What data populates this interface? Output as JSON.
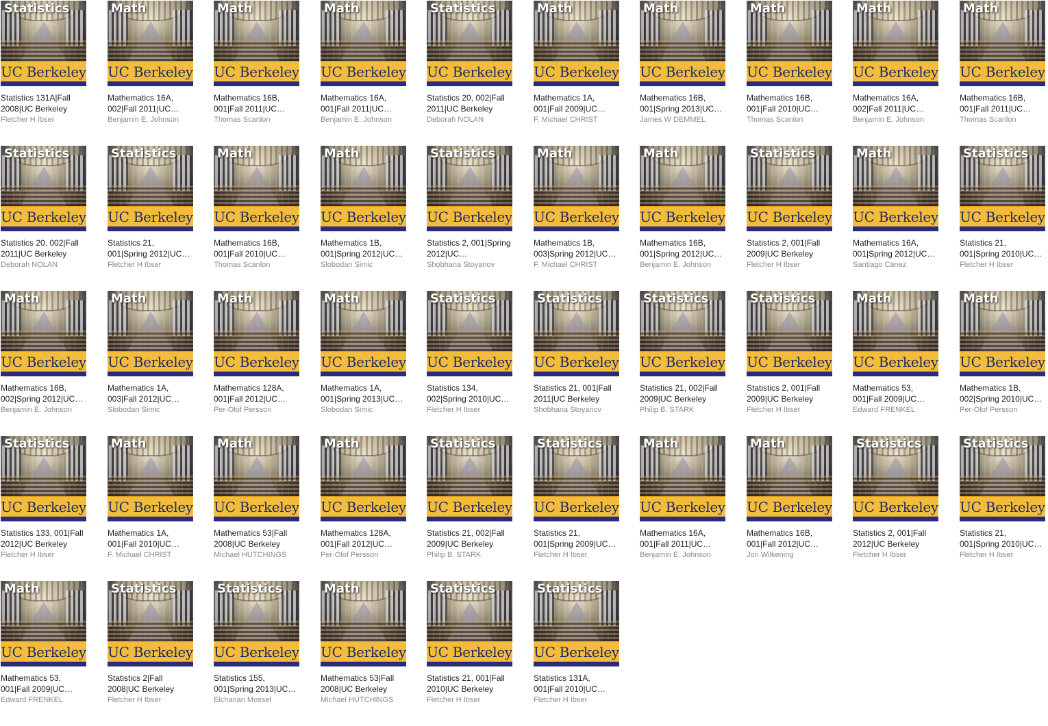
{
  "cover": {
    "brand": "UC Berkeley",
    "colors": {
      "gold": "#f3bc3a",
      "navy": "#2b2b7a",
      "brand_text": "#1f2a66"
    }
  },
  "rows": [
    [
      {
        "subject": "Statistics",
        "title": "Statistics 131A|Fall 2008|UC Berkeley",
        "author": "Fletcher H Ibser"
      },
      {
        "subject": "Math",
        "title": "Mathematics 16A, 002|Fall 2011|UC…",
        "author": "Benjamin E. Johnson"
      },
      {
        "subject": "Math",
        "title": "Mathematics 16B, 001|Fall 2011|UC…",
        "author": "Thomas Scanlon"
      },
      {
        "subject": "Math",
        "title": "Mathematics 16A, 001|Fall 2011|UC…",
        "author": "Benjamin E. Johnson"
      },
      {
        "subject": "Statistics",
        "title": "Statistics 20, 002|Fall 2011|UC Berkeley",
        "author": "Deborah NOLAN"
      },
      {
        "subject": "Math",
        "title": "Mathematics 1A, 001|Fall 2009|UC…",
        "author": "F. Michael CHRIST"
      },
      {
        "subject": "Math",
        "title": "Mathematics 16B, 001|Spring 2013|UC…",
        "author": "James W DEMMEL"
      },
      {
        "subject": "Math",
        "title": "Mathematics 16B, 001|Fall 2010|UC…",
        "author": "Thomas Scanlon"
      },
      {
        "subject": "Math",
        "title": "Mathematics 16A, 002|Fall 2011|UC…",
        "author": "Benjamin E. Johnson"
      },
      {
        "subject": "Math",
        "title": "Mathematics 16B, 001|Fall 2011|UC…",
        "author": "Thomas Scanlon"
      }
    ],
    [
      {
        "subject": "Statistics",
        "title": "Statistics 20, 002|Fall 2011|UC Berkeley",
        "author": "Deborah NOLAN"
      },
      {
        "subject": "Statistics",
        "title": "Statistics 21, 001|Spring 2012|UC…",
        "author": "Fletcher H Ibser"
      },
      {
        "subject": "Math",
        "title": "Mathematics 16B, 001|Fall 2010|UC…",
        "author": "Thomas Scanlon"
      },
      {
        "subject": "Math",
        "title": "Mathematics 1B, 001|Spring 2012|UC…",
        "author": "Slobodan Simic"
      },
      {
        "subject": "Statistics",
        "title": "Statistics 2, 001|Spring 2012|UC…",
        "author": "Shobhana Stoyanov"
      },
      {
        "subject": "Math",
        "title": "Mathematics 1B, 003|Spring 2012|UC…",
        "author": "F. Michael CHRIST"
      },
      {
        "subject": "Math",
        "title": "Mathematics 16B, 001|Spring 2012|UC…",
        "author": "Benjamin E. Johnson"
      },
      {
        "subject": "Statistics",
        "title": "Statistics 2, 001|Fall 2009|UC Berkeley",
        "author": "Fletcher H Ibser"
      },
      {
        "subject": "Math",
        "title": "Mathematics 16A, 001|Spring 2012|UC…",
        "author": "Santiago Canez"
      },
      {
        "subject": "Statistics",
        "title": "Statistics 21, 001|Spring 2010|UC…",
        "author": "Fletcher H Ibser"
      }
    ],
    [
      {
        "subject": "Math",
        "title": "Mathematics 16B, 002|Spring 2012|UC…",
        "author": "Benjamin E. Johnson"
      },
      {
        "subject": "Math",
        "title": "Mathematics 1A, 003|Fall 2012|UC…",
        "author": "Slobodan Simic"
      },
      {
        "subject": "Math",
        "title": "Mathematics 128A, 001|Fall 2012|UC…",
        "author": "Per-Olof Persson"
      },
      {
        "subject": "Math",
        "title": "Mathematics 1A, 001|Spring 2013|UC…",
        "author": "Slobodan Simic"
      },
      {
        "subject": "Statistics",
        "title": "Statistics 134, 002|Spring 2010|UC…",
        "author": "Fletcher H Ibser"
      },
      {
        "subject": "Statistics",
        "title": "Statistics 21, 001|Fall 2011|UC Berkeley",
        "author": "Shobhana Stoyanov"
      },
      {
        "subject": "Statistics",
        "title": "Statistics 21, 002|Fall 2009|UC Berkeley",
        "author": "Philip B. STARK"
      },
      {
        "subject": "Statistics",
        "title": "Statistics 2, 001|Fall 2009|UC Berkeley",
        "author": "Fletcher H Ibser"
      },
      {
        "subject": "Math",
        "title": "Mathematics 53, 001|Fall 2009|UC…",
        "author": "Edward FRENKEL"
      },
      {
        "subject": "Math",
        "title": "Mathematics 1B, 002|Spring 2010|UC…",
        "author": "Per-Olof Persson"
      }
    ],
    [
      {
        "subject": "Statistics",
        "title": "Statistics 133, 001|Fall 2012|UC Berkeley",
        "author": "Fletcher H Ibser"
      },
      {
        "subject": "Math",
        "title": "Mathematics 1A, 001|Fall 2010|UC…",
        "author": "F. Michael CHRIST"
      },
      {
        "subject": "Math",
        "title": "Mathematics 53|Fall 2008|UC Berkeley",
        "author": "Michael HUTCHINGS"
      },
      {
        "subject": "Math",
        "title": "Mathematics 128A, 001|Fall 2012|UC…",
        "author": "Per-Olof Persson"
      },
      {
        "subject": "Statistics",
        "title": "Statistics 21, 002|Fall 2009|UC Berkeley",
        "author": "Philip B. STARK"
      },
      {
        "subject": "Statistics",
        "title": "Statistics 21, 001|Spring 2009|UC…",
        "author": "Fletcher H Ibser"
      },
      {
        "subject": "Math",
        "title": "Mathematics 16A, 001|Fall 2011|UC…",
        "author": "Benjamin E. Johnson"
      },
      {
        "subject": "Math",
        "title": "Mathematics 16B, 001|Fall 2012|UC…",
        "author": "Jon Wilkening"
      },
      {
        "subject": "Statistics",
        "title": "Statistics 2, 001|Fall 2012|UC Berkeley",
        "author": "Fletcher H Ibser"
      },
      {
        "subject": "Statistics",
        "title": "Statistics 21, 001|Spring 2010|UC…",
        "author": "Fletcher H Ibser"
      }
    ],
    [
      {
        "subject": "Math",
        "title": "Mathematics 53, 001|Fall 2009|UC…",
        "author": "Edward FRENKEL"
      },
      {
        "subject": "Statistics",
        "title": "Statistics 2|Fall 2008|UC Berkeley",
        "author": "Fletcher H Ibser"
      },
      {
        "subject": "Statistics",
        "title": "Statistics 155, 001|Spring 2013|UC…",
        "author": "Elchanan Mossel"
      },
      {
        "subject": "Math",
        "title": "Mathematics 53|Fall 2008|UC Berkeley",
        "author": "Michael HUTCHINGS"
      },
      {
        "subject": "Statistics",
        "title": "Statistics 21, 001|Fall 2010|UC Berkeley",
        "author": "Fletcher H Ibser"
      },
      {
        "subject": "Statistics",
        "title": "Statistics 131A, 001|Fall 2010|UC…",
        "author": "Fletcher H Ibser"
      }
    ]
  ]
}
